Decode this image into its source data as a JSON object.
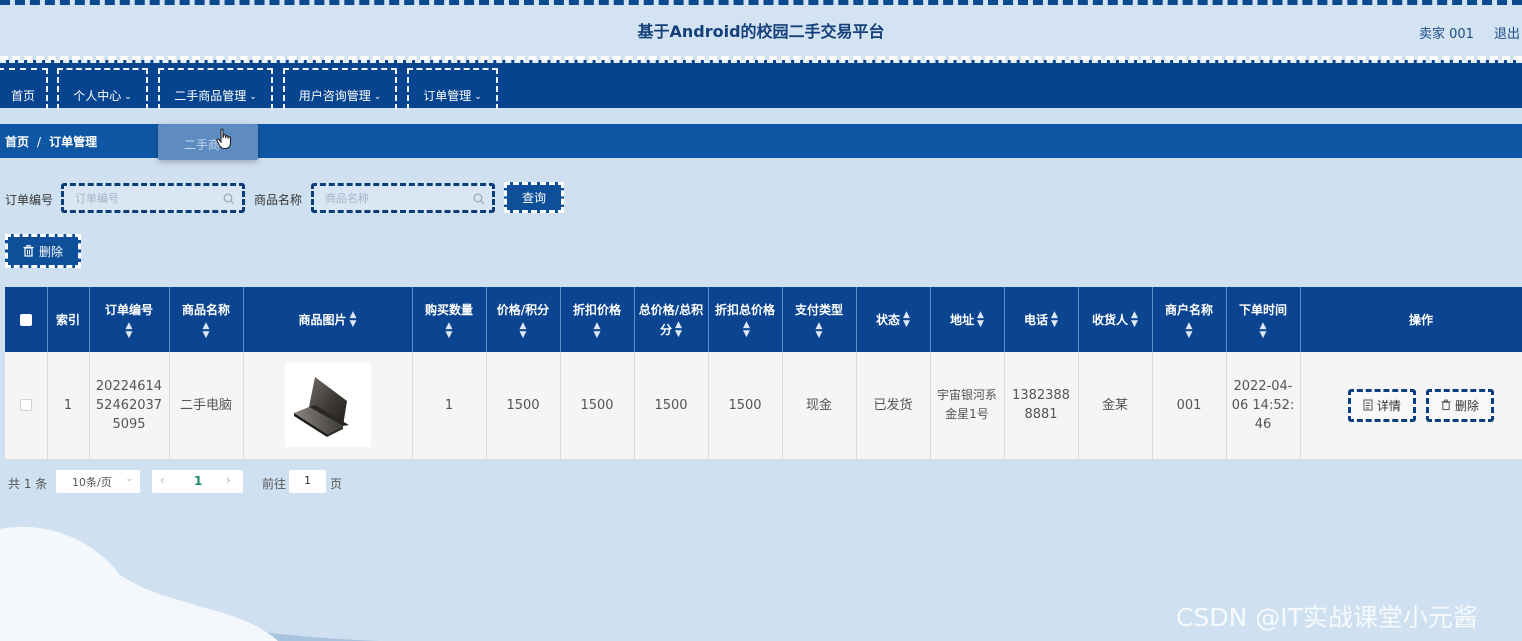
{
  "header": {
    "title": "基于Android的校园二手交易平台",
    "user": "卖家 001",
    "logout": "退出"
  },
  "nav": {
    "items": [
      {
        "label": "首页",
        "dropdown": false
      },
      {
        "label": "个人中心",
        "dropdown": true
      },
      {
        "label": "二手商品管理",
        "dropdown": true
      },
      {
        "label": "用户咨询管理",
        "dropdown": true
      },
      {
        "label": "订单管理",
        "dropdown": true
      }
    ],
    "submenu_popup": "二手商"
  },
  "breadcrumb": {
    "home": "首页",
    "separator": "/",
    "current": "订单管理"
  },
  "filters": {
    "order_no_label": "订单编号",
    "order_no_placeholder": "订单编号",
    "product_label": "商品名称",
    "product_placeholder": "商品名称",
    "query_button": "查询"
  },
  "toolbar": {
    "delete_button": "删除"
  },
  "table": {
    "columns": [
      "索引",
      "订单编号",
      "商品名称",
      "商品图片",
      "购买数量",
      "价格/积分",
      "折扣价格",
      "总价格/总积分",
      "折扣总价格",
      "支付类型",
      "状态",
      "地址",
      "电话",
      "收货人",
      "商户名称",
      "下单时间",
      "操作"
    ],
    "rows": [
      {
        "index": "1",
        "order_no": "20224614524620375095",
        "product_name": "二手电脑",
        "image_icon": "laptop-image",
        "quantity": "1",
        "price": "1500",
        "discount_price": "1500",
        "total_price": "1500",
        "discount_total": "1500",
        "pay_type": "现金",
        "status": "已发货",
        "address": "宇宙银河系金星1号",
        "phone": "13823888881",
        "receiver": "金某",
        "merchant": "001",
        "order_time": "2022-04-06 14:52:46"
      }
    ],
    "detail_button": "详情",
    "delete_button": "删除"
  },
  "pagination": {
    "total": "共 1 条",
    "page_size": "10条/页",
    "current_page": "1",
    "goto_label": "前往",
    "goto_value": "1",
    "page_suffix": "页"
  },
  "watermark": "CSDN @IT实战课堂小元酱",
  "colors": {
    "page_bg": "#cfe0f0",
    "nav_bg": "#07448f",
    "table_header_bg": "#0b4591",
    "crumb_bg": "#0f57a4",
    "title_text": "#14407a",
    "current_page": "#1d8a5e"
  }
}
